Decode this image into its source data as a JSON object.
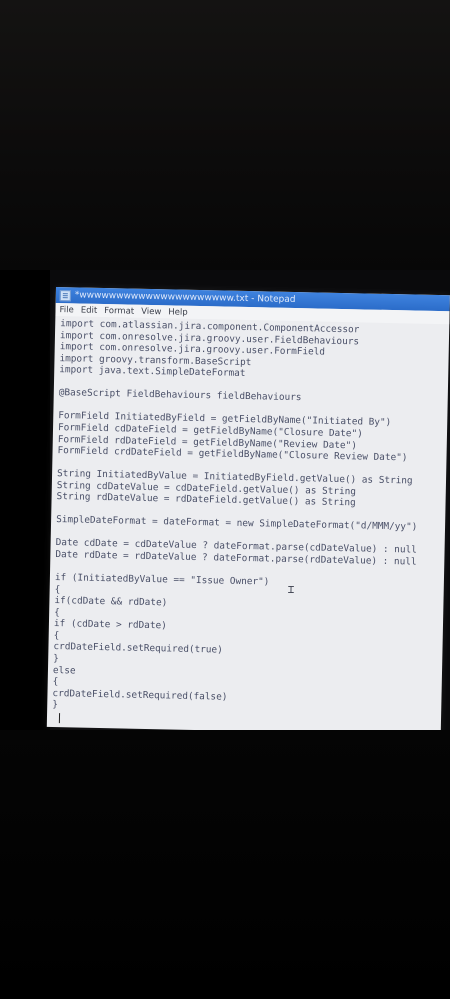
{
  "window": {
    "title": "*wwwwwwwwwwwwwwwwwwwww.txt - Notepad"
  },
  "menu": [
    "File",
    "Edit",
    "Format",
    "View",
    "Help"
  ],
  "code_lines": [
    "import com.atlassian.jira.component.ComponentAccessor",
    "import com.onresolve.jira.groovy.user.FieldBehaviours",
    "import com.onresolve.jira.groovy.user.FormField",
    "import groovy.transform.BaseScript",
    "import java.text.SimpleDateFormat",
    "",
    "@BaseScript FieldBehaviours fieldBehaviours",
    "",
    "FormField InitiatedByField = getFieldByName(\"Initiated By\")",
    "FormField cdDateField = getFieldByName(\"Closure Date\")",
    "FormField rdDateField = getFieldByName(\"Review Date\")",
    "FormField crdDateField = getFieldByName(\"Closure Review Date\")",
    "",
    "String InitiatedByValue = InitiatedByField.getValue() as String",
    "String cdDateValue = cdDateField.getValue() as String",
    "String rdDateValue = rdDateField.getValue() as String",
    "",
    "SimpleDateFormat = dateFormat = new SimpleDateFormat(\"d/MMM/yy\")",
    "",
    "Date cdDate = cdDateValue ? dateFormat.parse(cdDateValue) : null",
    "Date rdDate = rdDateValue ? dateFormat.parse(rdDateValue) : null",
    "",
    "if (InitiatedByValue == \"Issue Owner\")",
    "{",
    "if(cdDate && rdDate)",
    "{",
    "if (cdDate > rdDate)",
    "{",
    "crdDateField.setRequired(true)",
    "}",
    "else",
    "{",
    "crdDateField.setRequired(false)",
    "}"
  ]
}
